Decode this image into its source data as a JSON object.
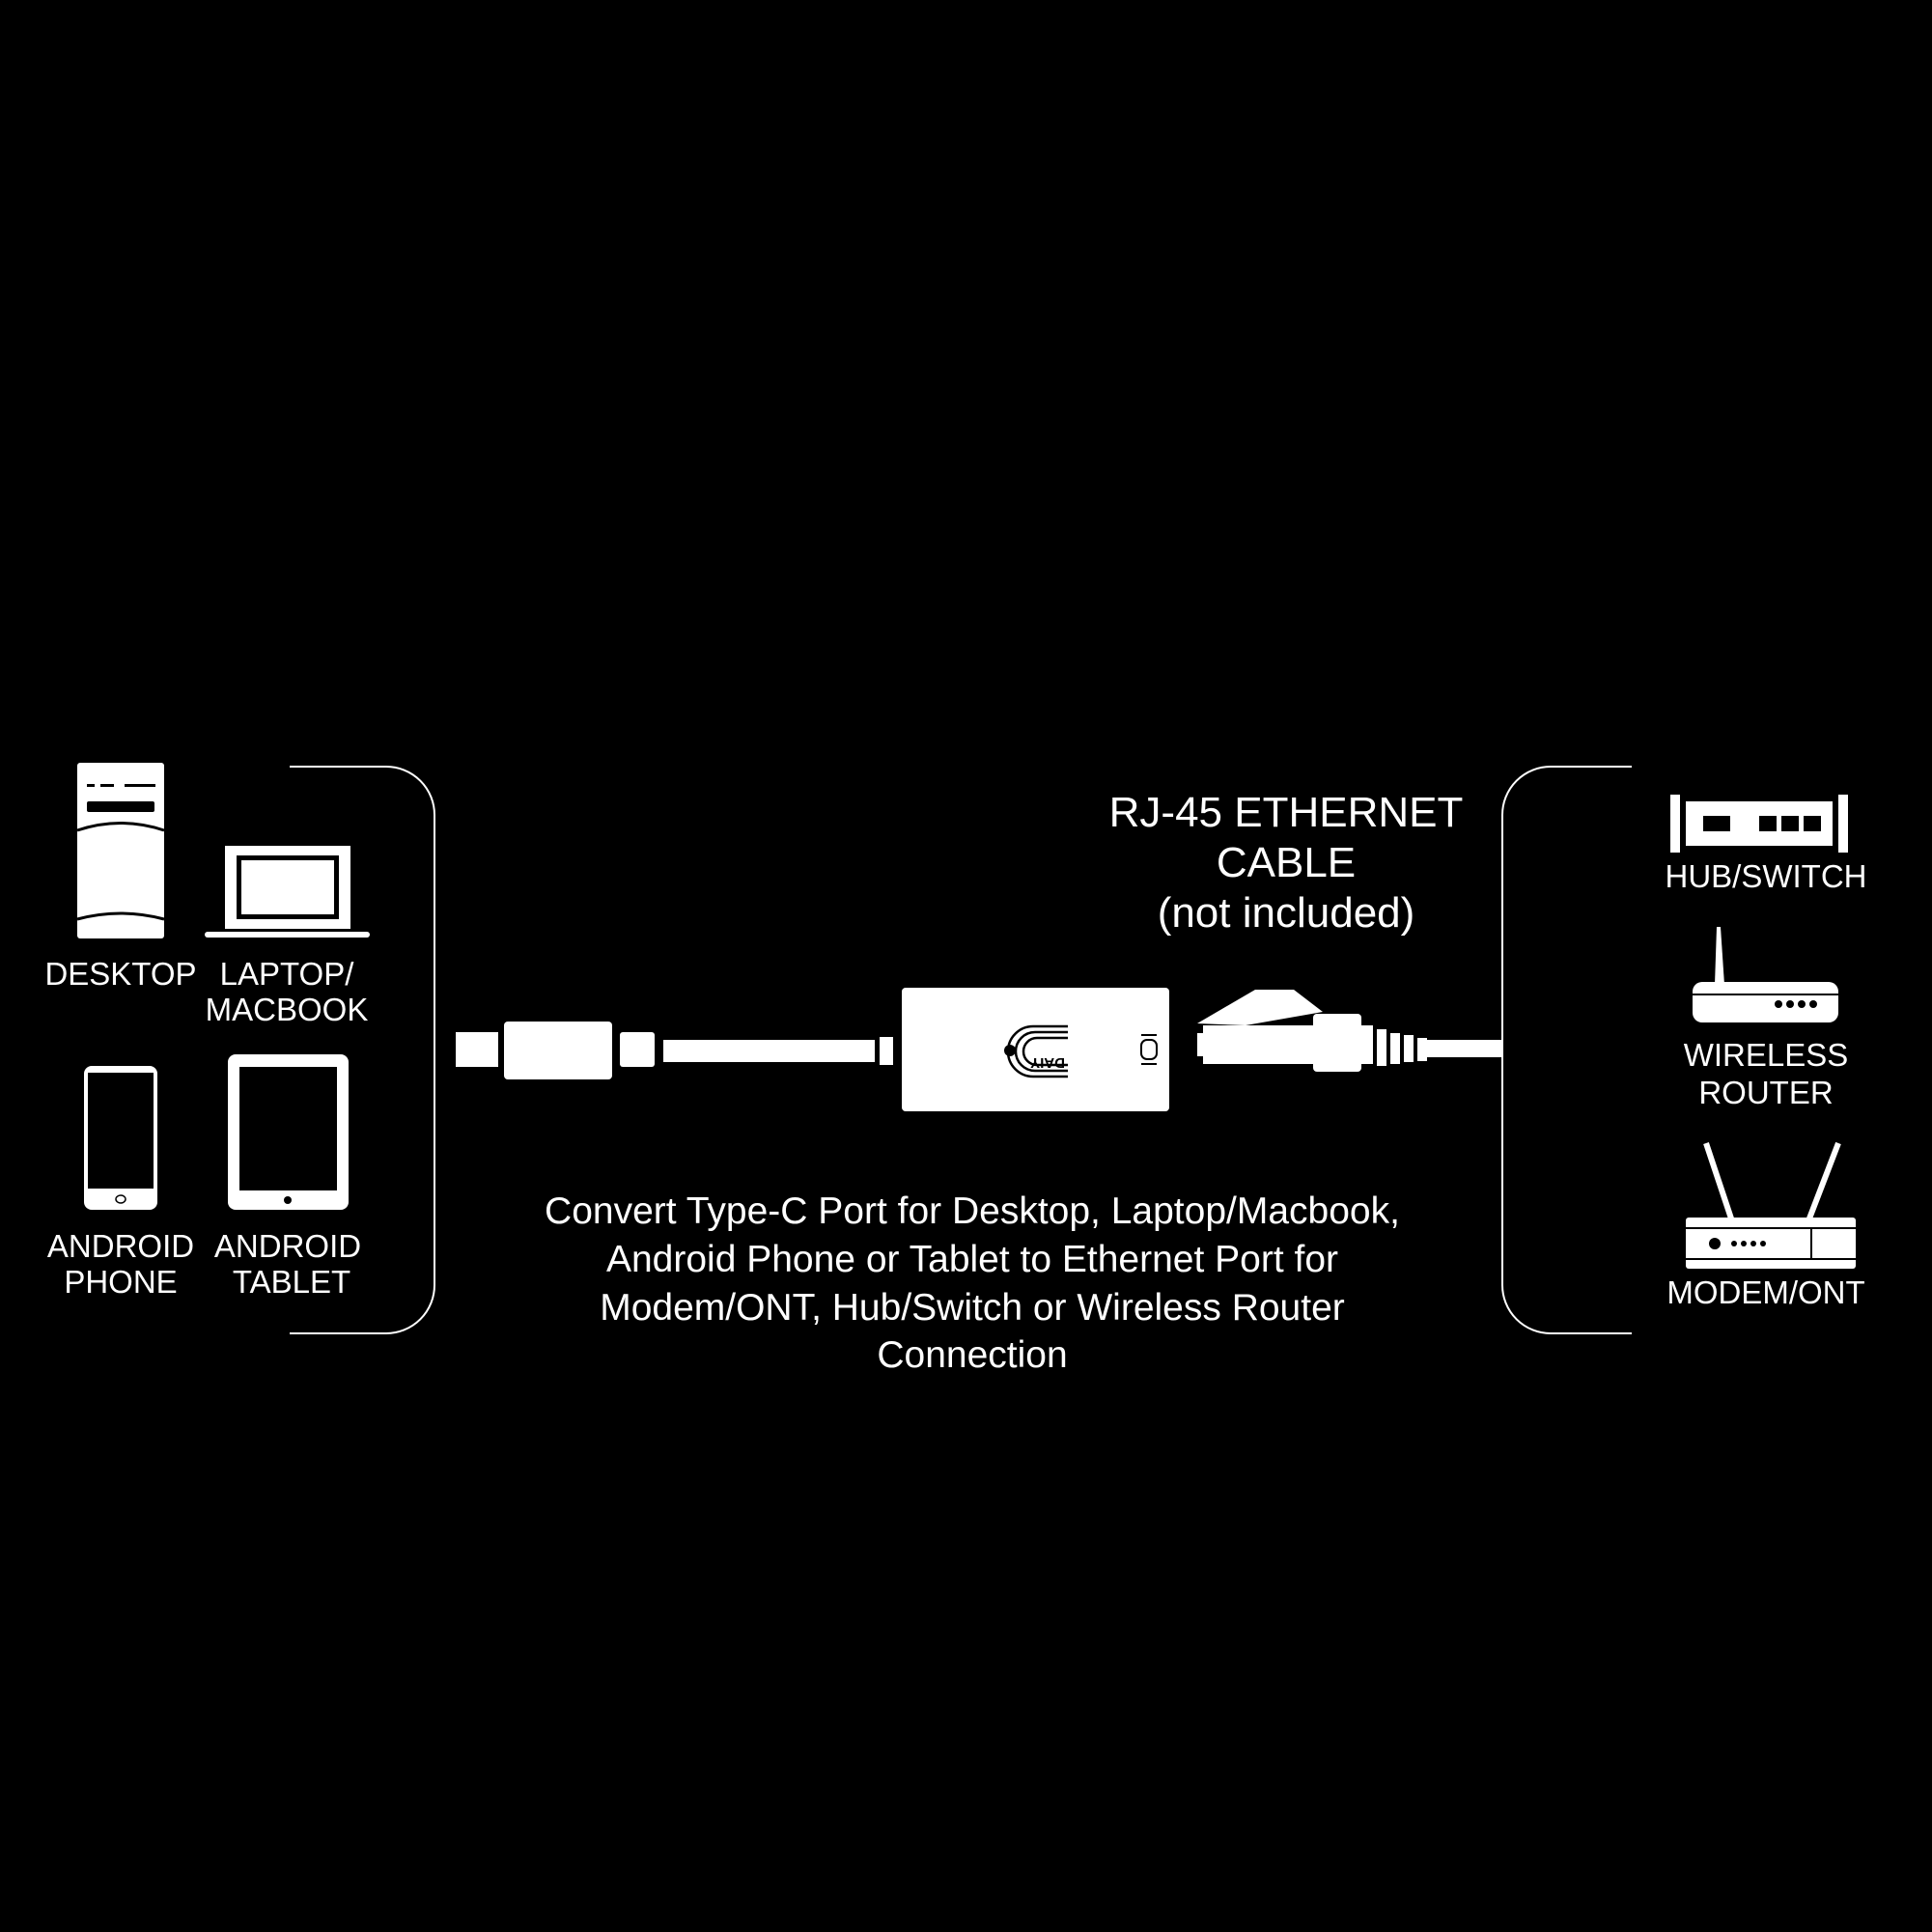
{
  "colors": {
    "background": "#000000",
    "foreground": "#ffffff"
  },
  "source_devices": [
    {
      "icon": "desktop-tower-icon",
      "label_lines": [
        "DESKTOP"
      ]
    },
    {
      "icon": "laptop-icon",
      "label_lines": [
        "LAPTOP/",
        "MACBOOK"
      ]
    },
    {
      "icon": "smartphone-icon",
      "label_lines": [
        "ANDROID",
        "PHONE"
      ]
    },
    {
      "icon": "tablet-icon",
      "label_lines": [
        "ANDROID",
        "TABLET"
      ]
    }
  ],
  "adapter": {
    "brand_logo": "DAIY"
  },
  "cable_label": {
    "lines": [
      "RJ-45 ETHERNET",
      "CABLE",
      "(not included)"
    ]
  },
  "description": {
    "lines": [
      "Convert Type-C Port for Desktop, Laptop/Macbook,",
      "Android Phone or Tablet to Ethernet Port for",
      "Modem/ONT, Hub/Switch or Wireless Router",
      "Connection"
    ]
  },
  "network_devices": [
    {
      "icon": "hub-switch-icon",
      "label_lines": [
        "HUB/SWITCH"
      ]
    },
    {
      "icon": "wireless-router-icon",
      "label_lines": [
        "WIRELESS",
        "ROUTER"
      ]
    },
    {
      "icon": "modem-ont-icon",
      "label_lines": [
        "MODEM/ONT"
      ]
    }
  ]
}
